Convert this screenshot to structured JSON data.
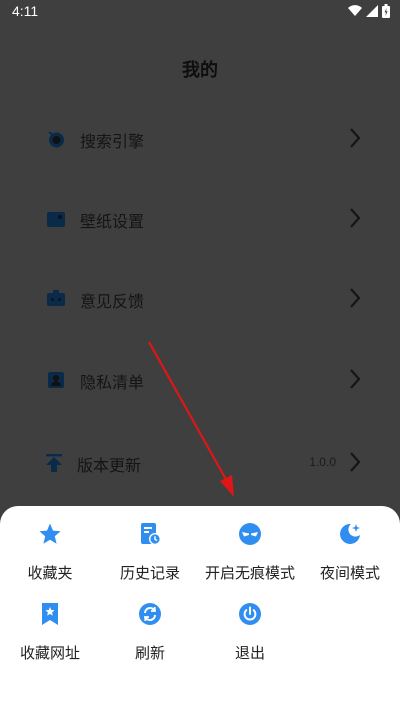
{
  "status_bar": {
    "time": "4:11"
  },
  "page": {
    "title": "我的"
  },
  "menu": [
    {
      "label": "搜索引擎",
      "icon": "search-engine-icon"
    },
    {
      "label": "壁纸设置",
      "icon": "wallpaper-icon"
    },
    {
      "label": "意见反馈",
      "icon": "feedback-icon"
    },
    {
      "label": "隐私清单",
      "icon": "privacy-icon"
    },
    {
      "label": "版本更新",
      "icon": "update-icon",
      "value": "1.0.0"
    }
  ],
  "sheet": {
    "actions": [
      {
        "label": "收藏夹",
        "icon": "star-icon"
      },
      {
        "label": "历史记录",
        "icon": "history-icon"
      },
      {
        "label": "开启无痕模式",
        "icon": "incognito-mask-icon"
      },
      {
        "label": "夜间模式",
        "icon": "night-mode-icon"
      },
      {
        "label": "收藏网址",
        "icon": "bookmark-icon"
      },
      {
        "label": "刷新",
        "icon": "refresh-icon"
      },
      {
        "label": "退出",
        "icon": "power-icon"
      }
    ]
  },
  "colors": {
    "accent": "#2f8ef0",
    "overlay_bg": "#3f3f3f",
    "sheet_bg": "#ffffff",
    "annotation_arrow": "#e01616"
  }
}
